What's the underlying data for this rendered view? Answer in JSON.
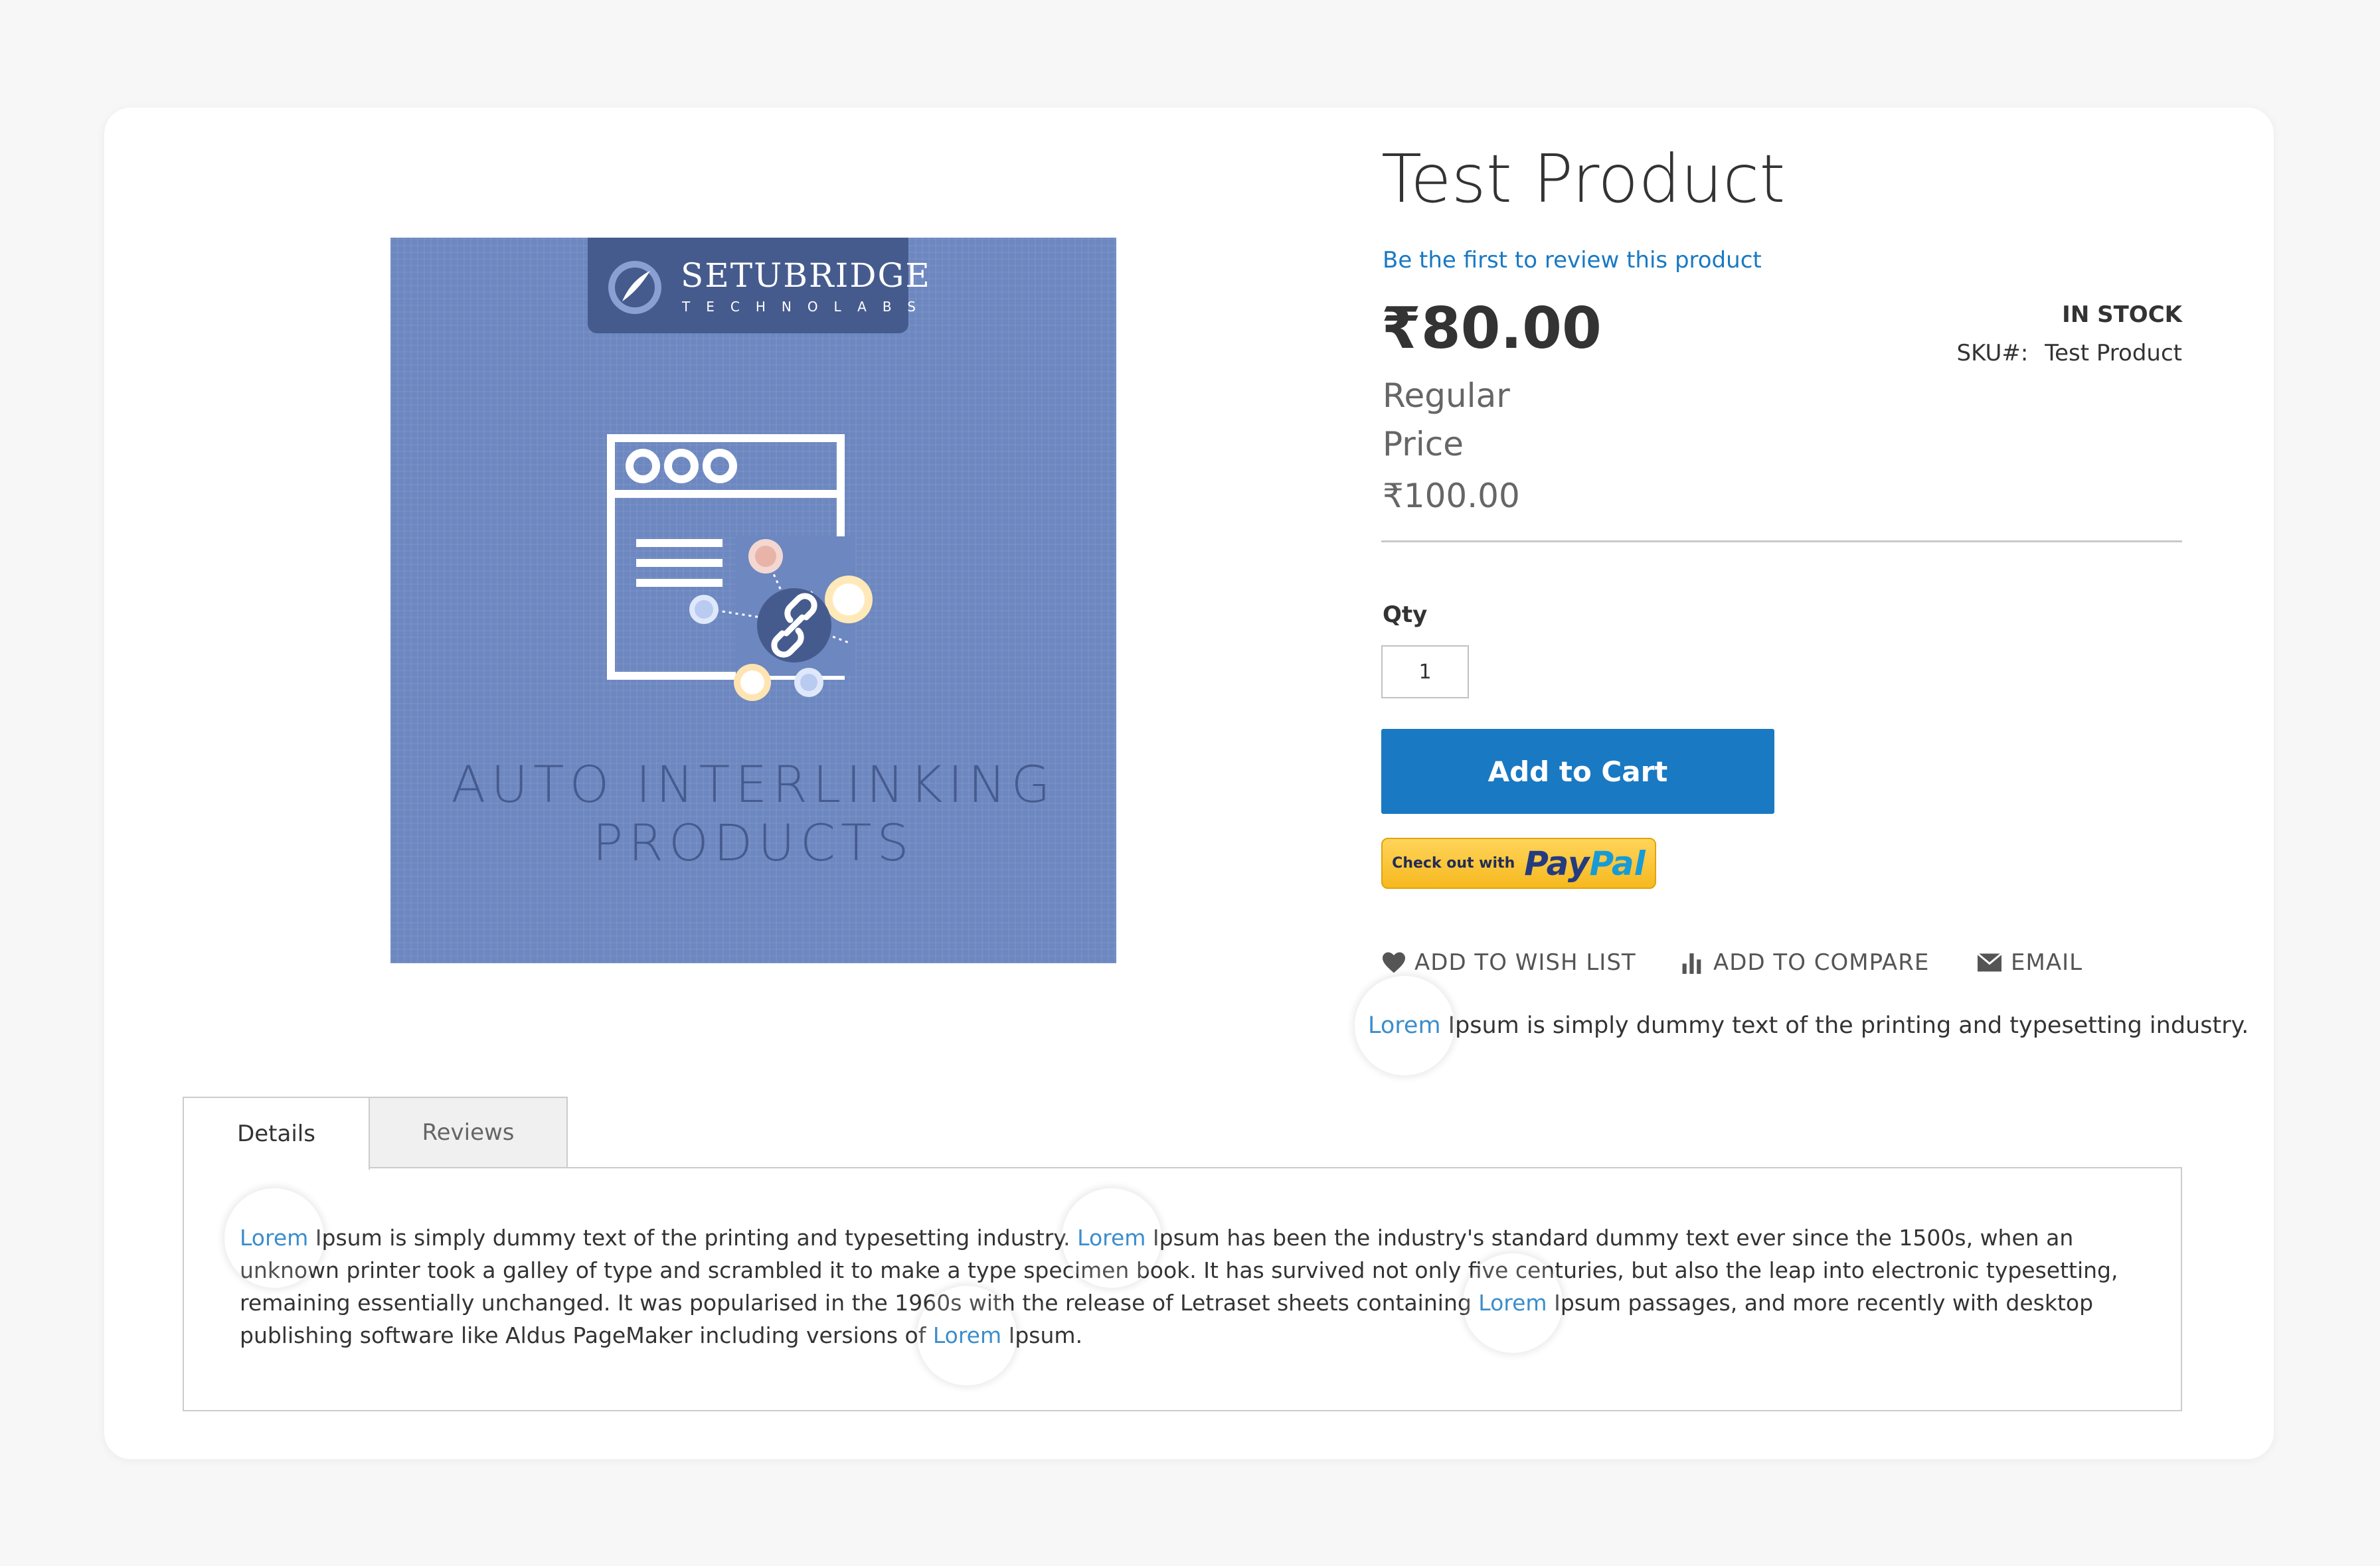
{
  "product": {
    "title": "Test Product",
    "review_link": "Be the first to review this product",
    "price": "₹80.00",
    "regular_price_label": "Regular\nPrice",
    "regular_price": "₹100.00",
    "stock_status": "IN STOCK",
    "sku_label": "SKU#:",
    "sku_value": "Test Product"
  },
  "image": {
    "brand_name": "SETUBRIDGE",
    "brand_sub": "TECHNOLABS",
    "title_line1": "AUTO INTERLINKING",
    "title_line2": "PRODUCTS"
  },
  "purchase": {
    "qty_label": "Qty",
    "qty_value": "1",
    "add_to_cart": "Add to Cart",
    "paypal_prefix": "Check out with",
    "paypal_pay": "Pay",
    "paypal_pal": "Pal"
  },
  "actions": {
    "wishlist": "ADD TO WISH LIST",
    "compare": "ADD TO COMPARE",
    "email": "EMAIL"
  },
  "short_description": {
    "keyword": "Lorem",
    "text": " Ipsum is simply dummy text of the printing and typesetting industry."
  },
  "tabs": [
    {
      "label": "Details"
    },
    {
      "label": "Reviews"
    }
  ],
  "details": {
    "kw1": "Lorem",
    "t1": " Ipsum is simply dummy text of the printing and typesetting industry. ",
    "kw2": "Lorem",
    "t2": " Ipsum has been the industry's standard dummy text ever since the 1500s, when an unknown printer took a galley of type and scrambled it to make a type specimen book. It has survived not only five centuries, but also the leap into electronic typesetting, remaining essentially unchanged. It was popularised in the 1960s with the release of Letraset sheets containing ",
    "kw3": "Lorem",
    "t3": " Ipsum passages, and more recently with desktop publishing software like Aldus PageMaker including versions of ",
    "kw4": "Lorem",
    "t4": " Ipsum."
  },
  "colors": {
    "link": "#1979c3",
    "button": "#1979c3",
    "image_bg": "#6d87c0",
    "paypal_yellow": "#ffc439"
  }
}
